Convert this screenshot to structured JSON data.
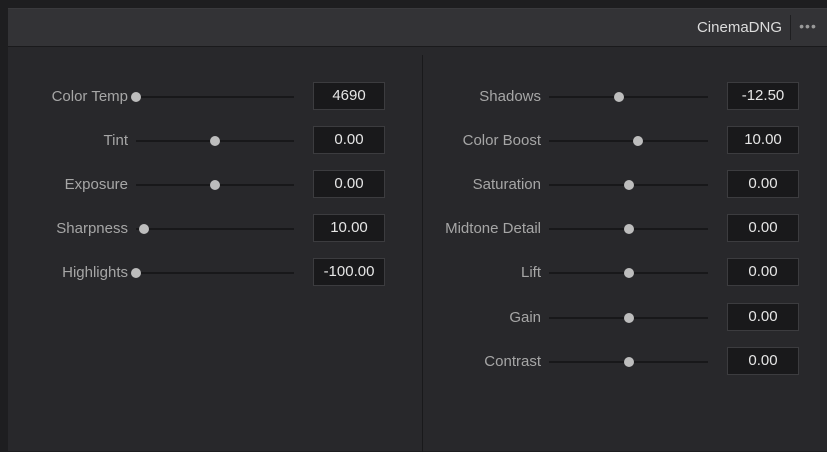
{
  "header": {
    "title": "CinemaDNG",
    "more_label": "•••"
  },
  "left_params": [
    {
      "label": "Color Temp",
      "value": "4690",
      "level": 0.0
    },
    {
      "label": "Tint",
      "value": "0.00",
      "level": 0.5
    },
    {
      "label": "Exposure",
      "value": "0.00",
      "level": 0.5
    },
    {
      "label": "Sharpness",
      "value": "10.00",
      "level": 0.05
    },
    {
      "label": "Highlights",
      "value": "-100.00",
      "level": 0.0
    }
  ],
  "right_params": [
    {
      "label": "Shadows",
      "value": "-12.50",
      "level": 0.44
    },
    {
      "label": "Color Boost",
      "value": "10.00",
      "level": 0.56
    },
    {
      "label": "Saturation",
      "value": "0.00",
      "level": 0.5
    },
    {
      "label": "Midtone Detail",
      "value": "0.00",
      "level": 0.5
    },
    {
      "label": "Lift",
      "value": "0.00",
      "level": 0.5
    },
    {
      "label": "Gain",
      "value": "0.00",
      "level": 0.5
    },
    {
      "label": "Contrast",
      "value": "0.00",
      "level": 0.5
    }
  ]
}
